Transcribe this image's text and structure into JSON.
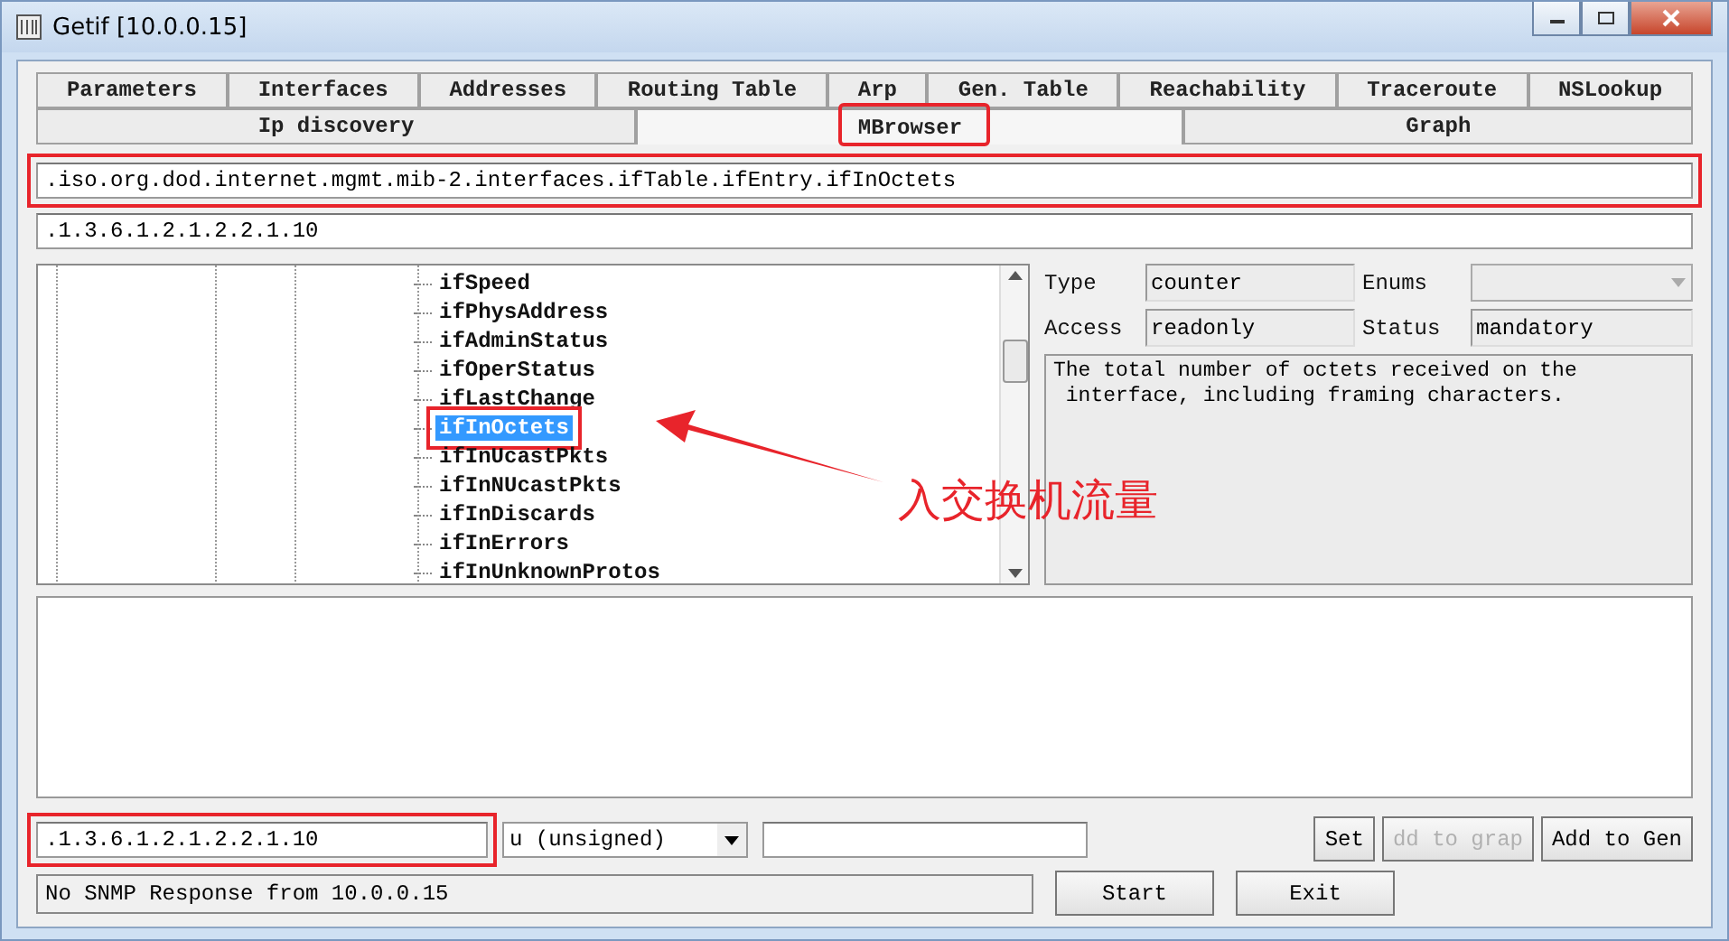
{
  "window": {
    "title": "Getif [10.0.0.15]"
  },
  "tab_rows": [
    [
      {
        "label": "Parameters",
        "selected": false
      },
      {
        "label": "Interfaces",
        "selected": false
      },
      {
        "label": "Addresses",
        "selected": false
      },
      {
        "label": "Routing Table",
        "selected": false
      },
      {
        "label": "Arp",
        "selected": false
      },
      {
        "label": "Gen. Table",
        "selected": false
      },
      {
        "label": "Reachability",
        "selected": false
      },
      {
        "label": "Traceroute",
        "selected": false
      },
      {
        "label": "NSLookup",
        "selected": false
      }
    ],
    [
      {
        "label": "Ip discovery",
        "selected": false
      },
      {
        "label": "MBrowser",
        "selected": true,
        "highlighted": true
      },
      {
        "label": "Graph",
        "selected": false
      }
    ]
  ],
  "oid_name": {
    "value": ".iso.org.dod.internet.mgmt.mib-2.interfaces.ifTable.ifEntry.ifInOctets",
    "highlighted": true
  },
  "oid_number": {
    "value": ".1.3.6.1.2.1.2.2.1.10"
  },
  "tree": {
    "items": [
      {
        "label": "ifSpeed",
        "selected": false
      },
      {
        "label": "ifPhysAddress",
        "selected": false
      },
      {
        "label": "ifAdminStatus",
        "selected": false
      },
      {
        "label": "ifOperStatus",
        "selected": false
      },
      {
        "label": "ifLastChange",
        "selected": false
      },
      {
        "label": "ifInOctets",
        "selected": true,
        "highlighted": true
      },
      {
        "label": "ifInUcastPkts",
        "selected": false
      },
      {
        "label": "ifInNUcastPkts",
        "selected": false
      },
      {
        "label": "ifInDiscards",
        "selected": false
      },
      {
        "label": "ifInErrors",
        "selected": false
      },
      {
        "label": "ifInUnknownProtos",
        "selected": false
      }
    ]
  },
  "details": {
    "type_label": "Type",
    "type": "counter",
    "enums_label": "Enums",
    "access_label": "Access",
    "access": "readonly",
    "status_label": "Status",
    "status": "mandatory",
    "description": "The total number of octets received on the\n interface, including framing characters."
  },
  "annotation": {
    "label": "入交换机流量"
  },
  "set_row": {
    "oid": {
      "value": ".1.3.6.1.2.1.2.2.1.10",
      "highlighted": true
    },
    "value_type": "u (unsigned)",
    "buttons": [
      {
        "label": "Set",
        "disabled": false
      },
      {
        "label": "dd to grap",
        "disabled": true
      },
      {
        "label": "Add to Gen",
        "disabled": false
      }
    ]
  },
  "status_bar": {
    "message": "No SNMP Response from 10.0.0.15",
    "buttons": [
      "Start",
      "Exit"
    ]
  }
}
